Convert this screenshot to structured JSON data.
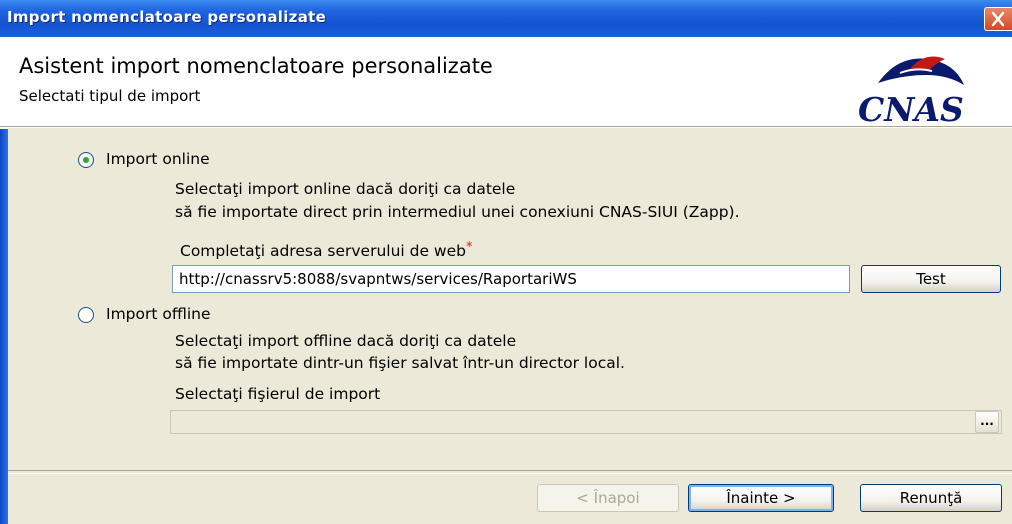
{
  "window": {
    "title": "Import nomenclatoare personalizate"
  },
  "header": {
    "title": "Asistent import nomenclatoare personalizate",
    "subtitle": "Selectati tipul de import",
    "logo_text": "CNAS"
  },
  "online": {
    "label": "Import online",
    "selected": true,
    "desc_line1": "Selectaţi import online dacă doriţi ca datele",
    "desc_line2": "să fie importate direct prin intermediul unei conexiuni CNAS-SIUI (Zapp).",
    "server_label": "Completaţi adresa serverului de web",
    "required_mark": "*",
    "server_url": "http://cnassrv5:8088/svapntws/services/RaportariWS",
    "test_label": "Test"
  },
  "offline": {
    "label": "Import offline",
    "selected": false,
    "desc_line1": "Selectaţi import offline dacă doriţi ca datele",
    "desc_line2": "să fie importate dintr-un fişier salvat într-un director local.",
    "file_label": "Selectaţi fişierul de import",
    "file_value": "",
    "browse_label": "..."
  },
  "footer": {
    "back_label": "< Înapoi",
    "next_label": "Înainte >",
    "cancel_label": "Renunţă"
  },
  "colors": {
    "titlebar": "#1454d1",
    "body": "#ece9d8",
    "radio_selected": "#2ea43a",
    "required": "#e01818"
  }
}
